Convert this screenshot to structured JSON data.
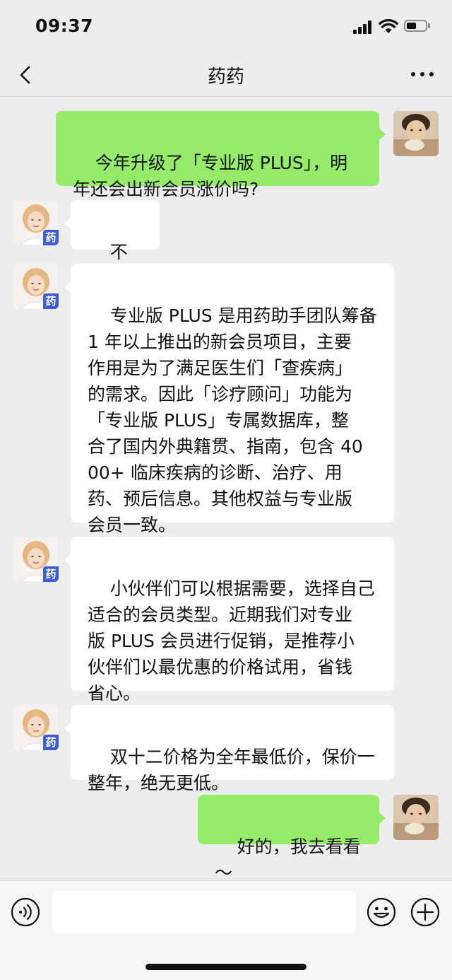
{
  "status_bar": {
    "time": "09:37",
    "icons": [
      "signal-icon",
      "wifi-icon",
      "battery-icon"
    ]
  },
  "nav": {
    "title": "药药",
    "back_icon": "chevron-left-icon",
    "more_icon": "more-dots-icon"
  },
  "messages": [
    {
      "from": "me",
      "text": "今年升级了「专业版 PLUS」，明\n年还会出新会员涨价吗?"
    },
    {
      "from": "assistant",
      "text": "不会。",
      "avatar_badge": "药"
    },
    {
      "from": "assistant",
      "text": "专业版 PLUS 是用药助手团队筹备\n1 年以上推出的新会员项目，主要\n作用是为了满足医生们「查疾病」\n的需求。因此「诊疗顾问」功能为\n「专业版 PLUS」专属数据库，整\n合了国内外典籍贯、指南，包含 40\n00+ 临床疾病的诊断、治疗、用\n药、预后信息。其他权益与专业版\n会员一致。",
      "avatar_badge": "药"
    },
    {
      "from": "assistant",
      "text": "小伙伴们可以根据需要，选择自己\n适合的会员类型。近期我们对专业\n版 PLUS 会员进行促销，是推荐小\n伙伴们以最优惠的价格试用，省钱\n省心。",
      "avatar_badge": "药"
    },
    {
      "from": "assistant",
      "text": "双十二价格为全年最低价，保价一\n整年，绝无更低。",
      "avatar_badge": "药"
    },
    {
      "from": "me",
      "text": "好的，我去看看～"
    }
  ],
  "input_bar": {
    "input_value": "",
    "icons": [
      "voice-icon",
      "emoji-icon",
      "plus-icon"
    ]
  },
  "colors": {
    "background": "#ededed",
    "outgoing_bubble": "#95ec69",
    "incoming_bubble": "#ffffff",
    "badge": "#3e5bd8"
  }
}
